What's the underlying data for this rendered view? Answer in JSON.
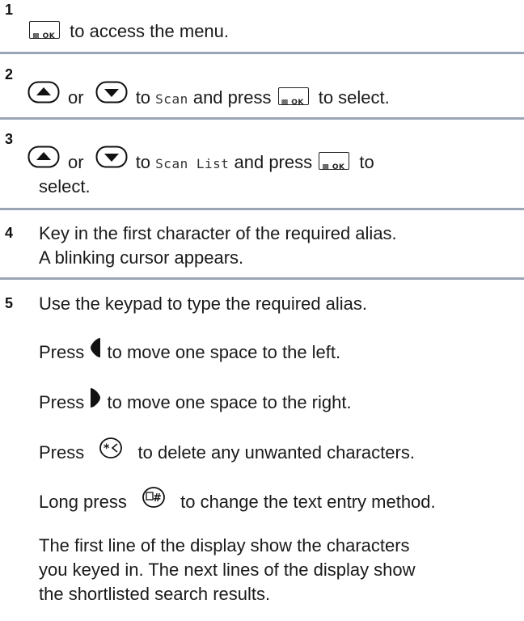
{
  "steps": [
    {
      "num": "1",
      "after_ok": "to access the menu.",
      "ok_label": "OK"
    },
    {
      "num": "2",
      "or": "or",
      "to": "to",
      "target": "Scan",
      "and_press": "and press",
      "to_select": "to select."
    },
    {
      "num": "3",
      "or": "or",
      "to": "to",
      "target": "Scan List",
      "and_press": "and press",
      "to_word": "to",
      "select_word": "select."
    },
    {
      "num": "4",
      "line1": "Key in the first character of the required alias.",
      "line2": "A blinking cursor appears."
    },
    {
      "num": "5",
      "line1": "Use the keypad to type the required alias."
    }
  ],
  "press": {
    "word": "Press",
    "left_text": "to move one space to the left.",
    "right_text": "to move one space to the right.",
    "delete_text": "to delete any unwanted characters.",
    "long_press": "Long press",
    "method_text": "to change the text entry method."
  },
  "footer": {
    "line1": "The first line of the display show the characters",
    "line2": "you keyed in. The next lines of the display show",
    "line3": "the shortlisted search results."
  },
  "icons": [
    "menu-ok-key-icon",
    "up-arrow-key-icon",
    "down-arrow-key-icon",
    "left-arrow-icon",
    "right-arrow-icon",
    "star-delete-key-icon",
    "hash-key-icon"
  ]
}
